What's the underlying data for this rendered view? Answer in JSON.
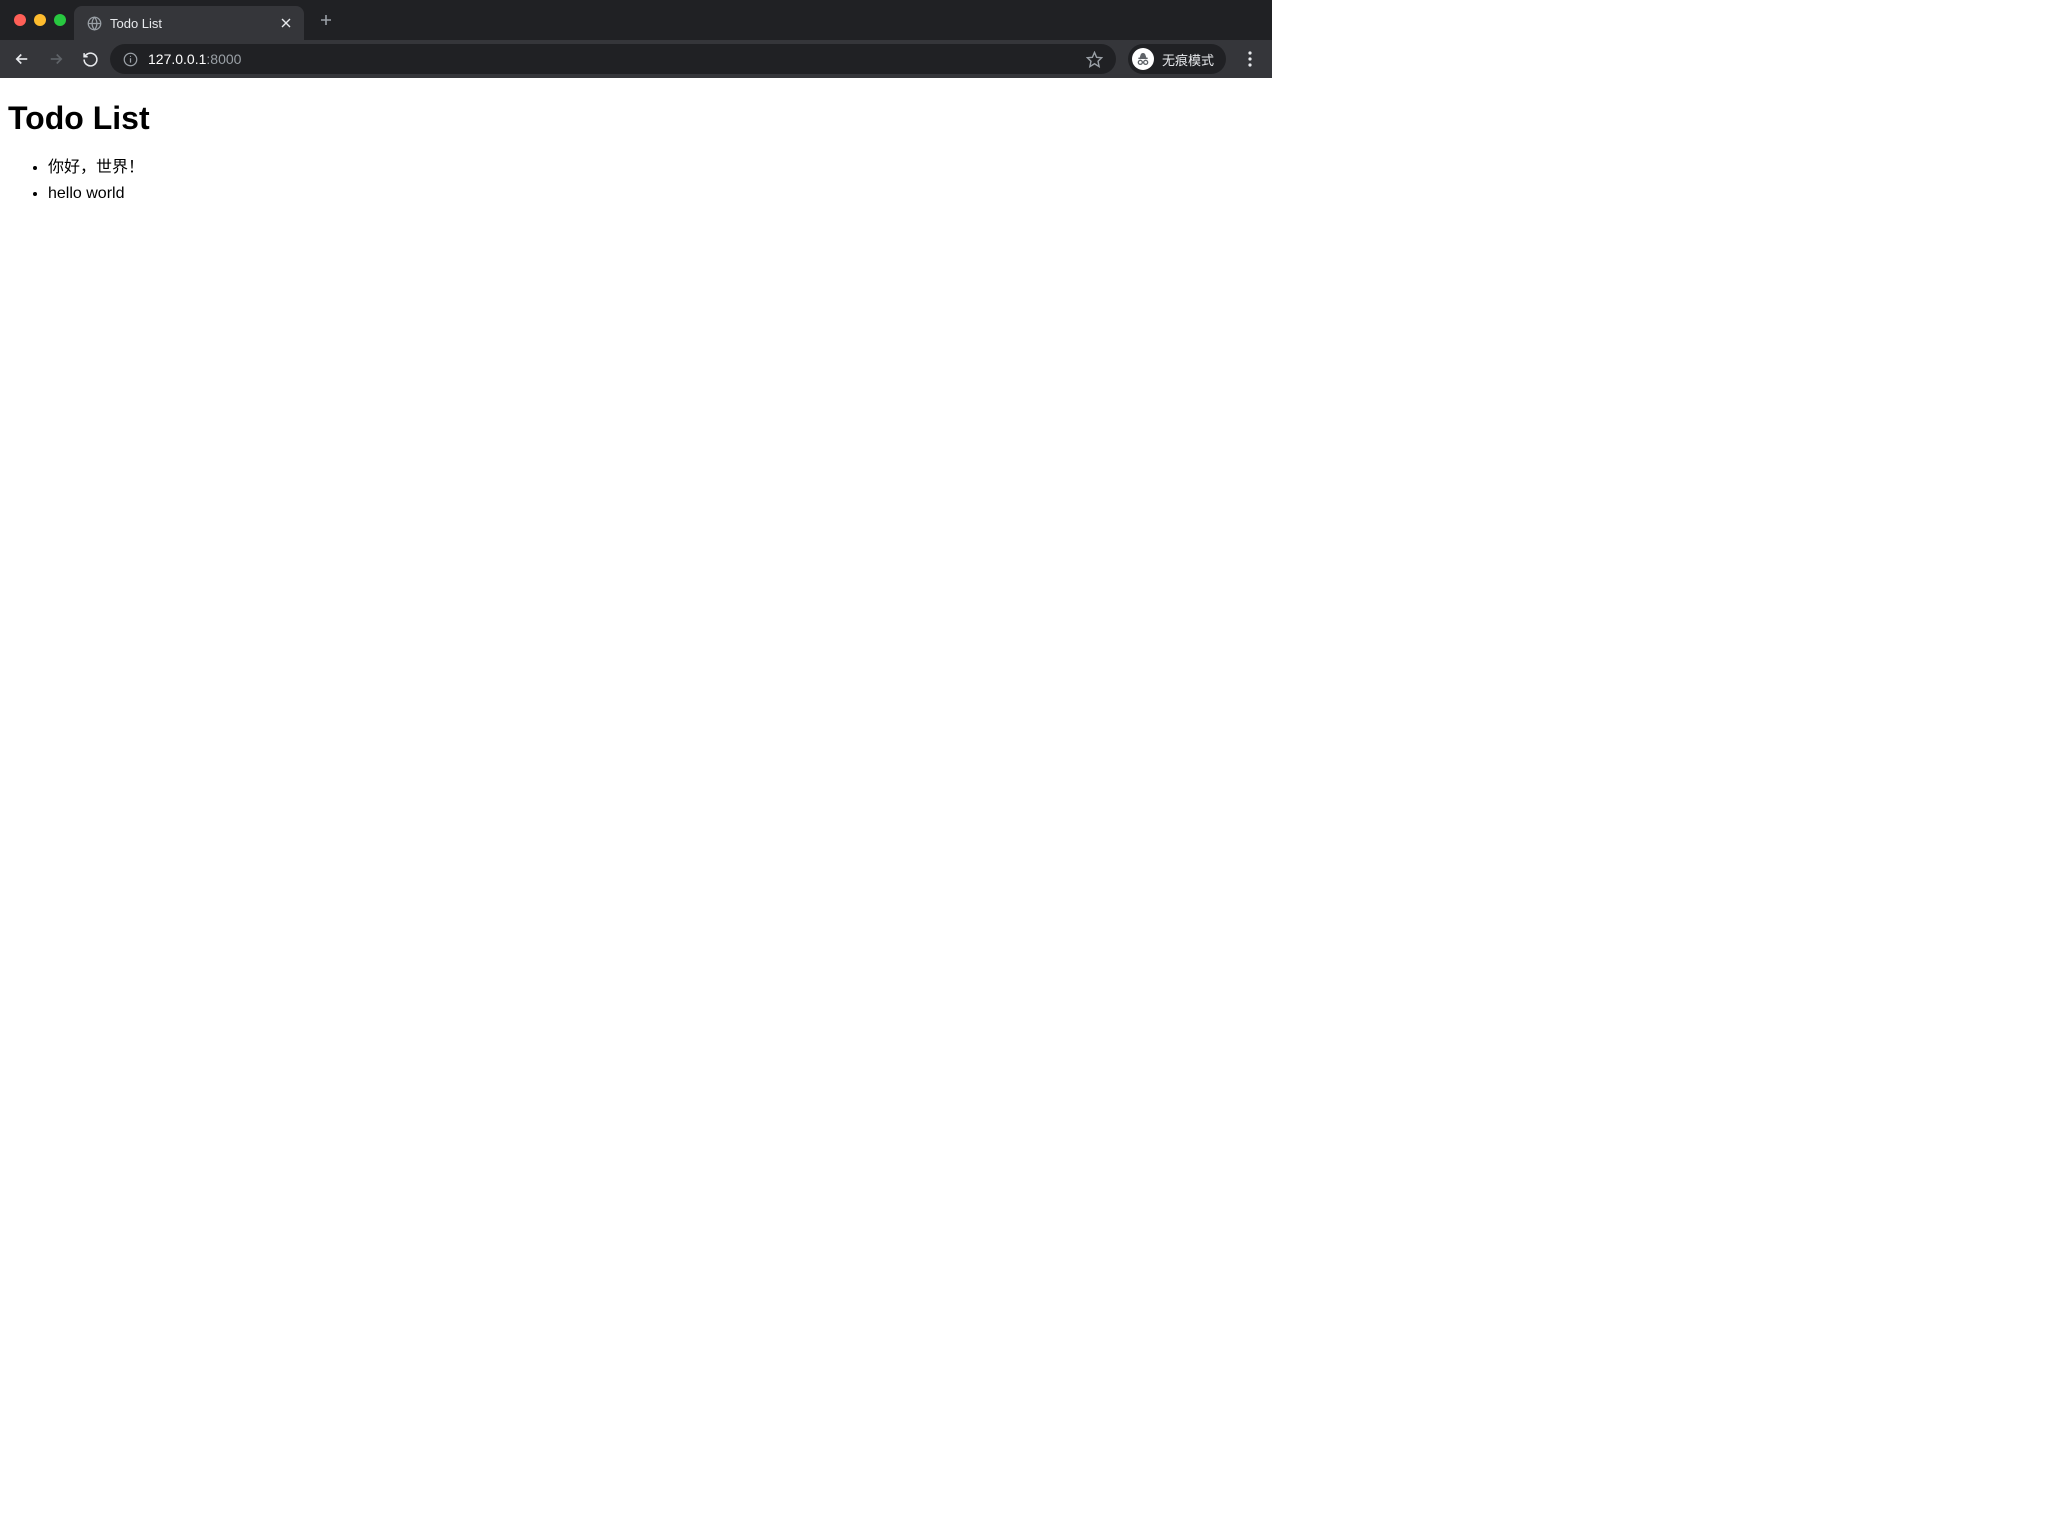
{
  "browser": {
    "tab": {
      "title": "Todo List"
    },
    "address": {
      "host": "127.0.0.1",
      "port": ":8000"
    },
    "incognito_label": "无痕模式"
  },
  "page": {
    "heading": "Todo List",
    "items": [
      "你好，世界！",
      "hello world"
    ]
  }
}
